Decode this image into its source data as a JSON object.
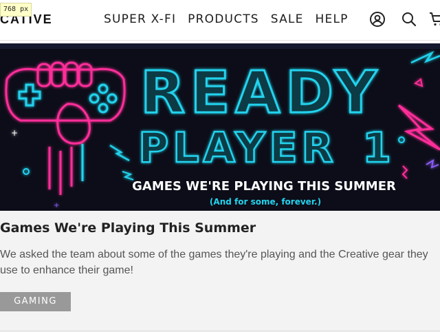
{
  "viewport_badge": "768 px",
  "header": {
    "logo_text": "CATIVE",
    "nav": [
      "SUPER X-FI",
      "PRODUCTS",
      "SALE",
      "HELP"
    ]
  },
  "hero": {
    "line1": "READY",
    "line2": "PLAYER",
    "line2_numeral": "1",
    "subtitle": "GAMES WE'RE PLAYING THIS SUMMER",
    "tagline": "(And for some, forever.)",
    "colors": {
      "pink": "#ff2d9a",
      "cyan": "#22d3ee",
      "bg": "#0c0d18"
    }
  },
  "article": {
    "title": "Games We're Playing This Summer",
    "description": "We asked the team about some of the games they're playing and the Creative gear they use to enhance their game!",
    "tag": "GAMING"
  }
}
